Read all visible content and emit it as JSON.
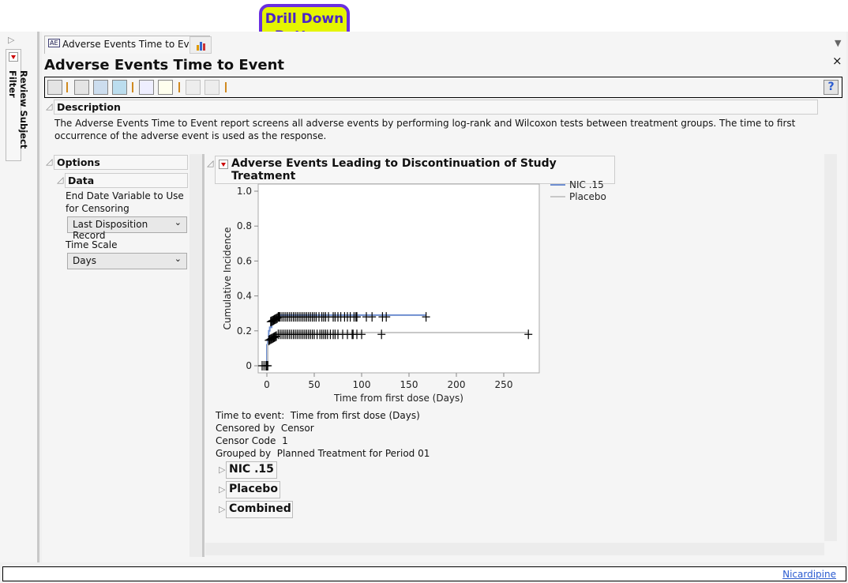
{
  "window": {
    "tab_label": "Adverse Events Time to Event",
    "report_title": "Adverse Events Time to Event",
    "close_label": "×",
    "help_label": "?"
  },
  "left_panel": {
    "label": "Review Subject Filter"
  },
  "callout": {
    "line1": "Drill Down",
    "line2": "Buttons"
  },
  "description": {
    "header": "Description",
    "text": "The Adverse Events Time to Event report screens all adverse events by performing log-rank and Wilcoxon tests between treatment groups. The time to first occurrence of the adverse event is used as the response."
  },
  "options": {
    "header": "Options",
    "data_header": "Data",
    "end_date_label": "End Date Variable to Use for Censoring",
    "end_date_value": "Last Disposition Record",
    "time_scale_label": "Time Scale",
    "time_scale_value": "Days"
  },
  "report": {
    "header": "Adverse Events Leading to Discontinuation of Study Treatment",
    "info": [
      {
        "label": "Time to event:",
        "value": "Time from first dose (Days)"
      },
      {
        "label": "Censored by",
        "value": "Censor"
      },
      {
        "label": "Censor Code",
        "value": "1"
      },
      {
        "label": "Grouped by",
        "value": "Planned Treatment for Period 01"
      }
    ],
    "groups": [
      "NIC .15",
      "Placebo",
      "Combined"
    ]
  },
  "status": {
    "link": "Nicardipine"
  },
  "colors": {
    "nic": "#6f8fd0",
    "placebo": "#c8c8c8",
    "callout_bg": "#e5f500",
    "callout_border": "#6a2fe0"
  },
  "chart_data": {
    "type": "line",
    "xlabel": "Time from first dose (Days)",
    "ylabel": "Cumulative Incidence",
    "xlim": [
      -9,
      290
    ],
    "ylim": [
      -0.03,
      1.04
    ],
    "xticks": [
      0,
      50,
      100,
      150,
      200,
      250
    ],
    "yticks": [
      0,
      0.2,
      0.4,
      0.6,
      0.8,
      1.0
    ],
    "yticklabels": [
      "0",
      "0.2",
      "0.4",
      "0.6",
      "0.8",
      "1.0"
    ],
    "legend": "right",
    "series": [
      {
        "name": "NIC .15",
        "steps": [
          [
            -1,
            0
          ],
          [
            0,
            0
          ],
          [
            0,
            0.12
          ],
          [
            1,
            0.15
          ],
          [
            2,
            0.2
          ],
          [
            3,
            0.22
          ],
          [
            5,
            0.25
          ],
          [
            7,
            0.27
          ],
          [
            10,
            0.28
          ],
          [
            14,
            0.29
          ],
          [
            168,
            0.29
          ]
        ],
        "censor_y": 0.28,
        "censor": [
          4,
          5,
          6,
          7,
          8,
          9,
          10,
          11,
          12,
          13,
          14,
          16,
          18,
          20,
          22,
          24,
          26,
          28,
          30,
          32,
          34,
          36,
          38,
          40,
          42,
          44,
          46,
          48,
          50,
          52,
          55,
          58,
          60,
          62,
          65,
          70,
          72,
          75,
          78,
          82,
          85,
          88,
          92,
          94,
          95,
          105,
          111,
          122,
          126,
          168
        ]
      },
      {
        "name": "Placebo",
        "steps": [
          [
            0,
            0
          ],
          [
            1,
            0
          ],
          [
            1,
            0.12
          ],
          [
            2,
            0.15
          ],
          [
            4,
            0.17
          ],
          [
            8,
            0.18
          ],
          [
            12,
            0.19
          ],
          [
            276,
            0.19
          ]
        ],
        "censor_y": 0.18,
        "censor": [
          2,
          3,
          4,
          5,
          6,
          7,
          8,
          9,
          10,
          12,
          14,
          16,
          18,
          20,
          22,
          24,
          26,
          28,
          30,
          32,
          34,
          36,
          38,
          40,
          42,
          44,
          46,
          48,
          50,
          53,
          56,
          58,
          60,
          62,
          64,
          67,
          70,
          72,
          75,
          80,
          85,
          90,
          91,
          95,
          100,
          121,
          276
        ]
      }
    ],
    "zero_censor": [
      -5,
      -3,
      -1,
      0,
      1
    ]
  }
}
